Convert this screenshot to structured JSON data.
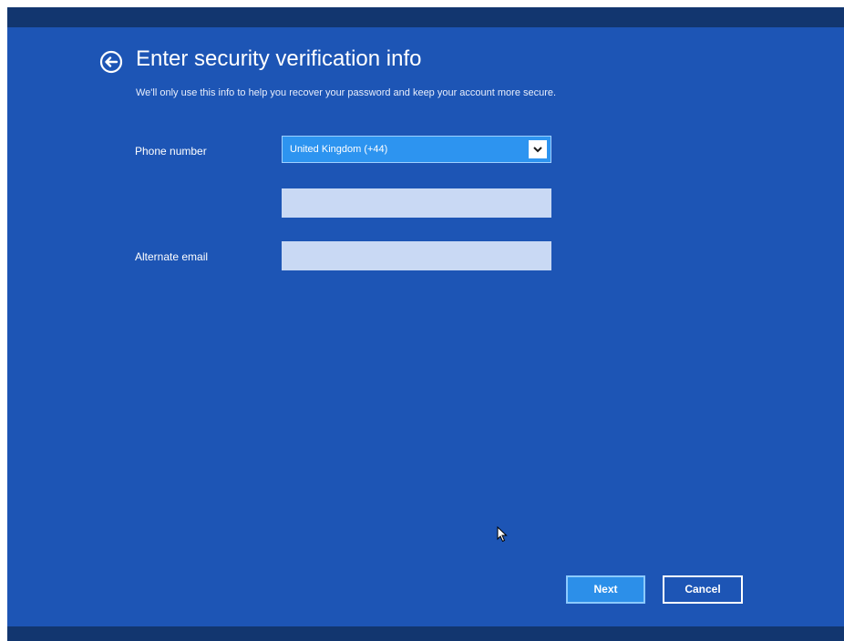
{
  "header": {
    "title": "Enter security verification info",
    "subtitle": "We'll only use this info to help you recover your password and keep your account more secure."
  },
  "form": {
    "phone_label": "Phone number",
    "country_value": "United Kingdom (+44)",
    "phone_value": "",
    "email_label": "Alternate email",
    "email_value": ""
  },
  "buttons": {
    "next_label": "Next",
    "cancel_label": "Cancel"
  },
  "icons": {
    "back": "back-arrow-icon",
    "dropdown": "chevron-down-icon",
    "cursor": "mouse-pointer-icon"
  },
  "colors": {
    "background": "#1d55b5",
    "bar": "#12366f",
    "accent": "#2d94f0",
    "field": "#c9d9f4"
  }
}
